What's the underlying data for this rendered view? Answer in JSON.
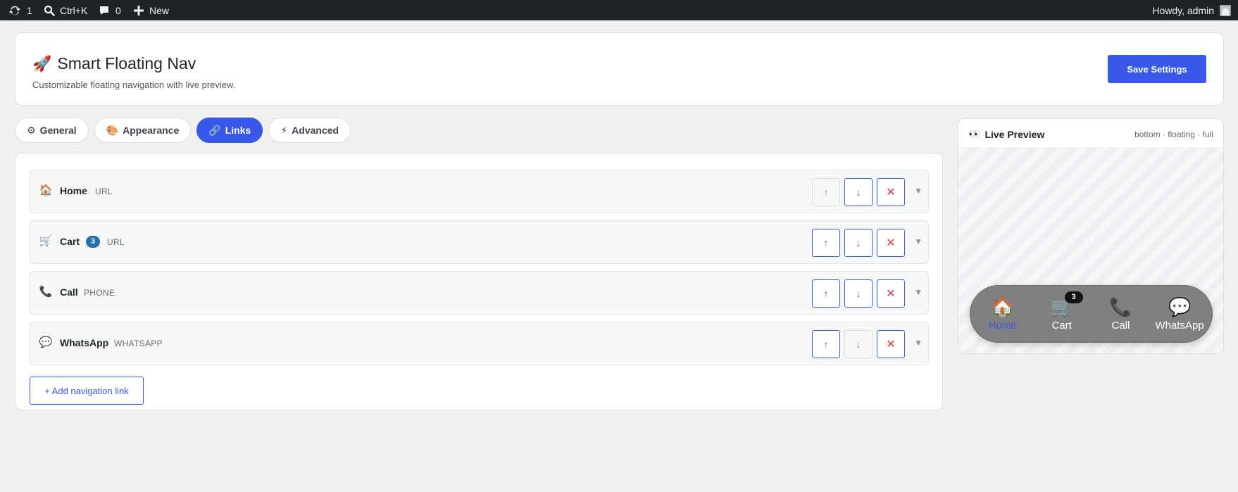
{
  "admin_bar": {
    "updates_count": "1",
    "search_shortcut": "Ctrl+K",
    "comments_count": "0",
    "new_label": "New",
    "howdy": "Howdy, admin"
  },
  "header": {
    "icon": "🚀",
    "title": "Smart Floating Nav",
    "subtitle": "Customizable floating navigation with live preview.",
    "save_label": "Save Settings"
  },
  "tabs": [
    {
      "icon": "⚙",
      "label": "General",
      "active": false
    },
    {
      "icon": "🎨",
      "label": "Appearance",
      "active": false
    },
    {
      "icon": "🔗",
      "label": "Links",
      "active": true
    },
    {
      "icon": "⚡",
      "label": "Advanced",
      "active": false
    }
  ],
  "links": [
    {
      "icon": "🏠",
      "label": "Home",
      "badge": "",
      "type": "URL"
    },
    {
      "icon": "🛒",
      "label": "Cart",
      "badge": "3",
      "type": "URL"
    },
    {
      "icon": "📞",
      "label": "Call",
      "badge": "",
      "type": "PHONE"
    },
    {
      "icon": "💬",
      "label": "WhatsApp",
      "badge": "",
      "type": "WHATSAPP"
    }
  ],
  "row_buttons": {
    "up": "↑",
    "down": "↓",
    "delete": "✕",
    "caret": "▼"
  },
  "add_link_label": "+ Add navigation link",
  "preview": {
    "icon": "👀",
    "title": "Live Preview",
    "meta": "bottom · floating · full",
    "nav_items": [
      {
        "icon": "🏠",
        "label": "Home",
        "badge": "",
        "active": true
      },
      {
        "icon": "🛒",
        "label": "Cart",
        "badge": "3",
        "active": false
      },
      {
        "icon": "📞",
        "label": "Call",
        "badge": "",
        "active": false
      },
      {
        "icon": "💬",
        "label": "WhatsApp",
        "badge": "",
        "active": false
      }
    ]
  },
  "colors": {
    "accent": "#3858e9",
    "adminbar": "#1d2327",
    "danger": "#d63638",
    "badge": "#2271b1",
    "nav_bg": "#808080"
  }
}
